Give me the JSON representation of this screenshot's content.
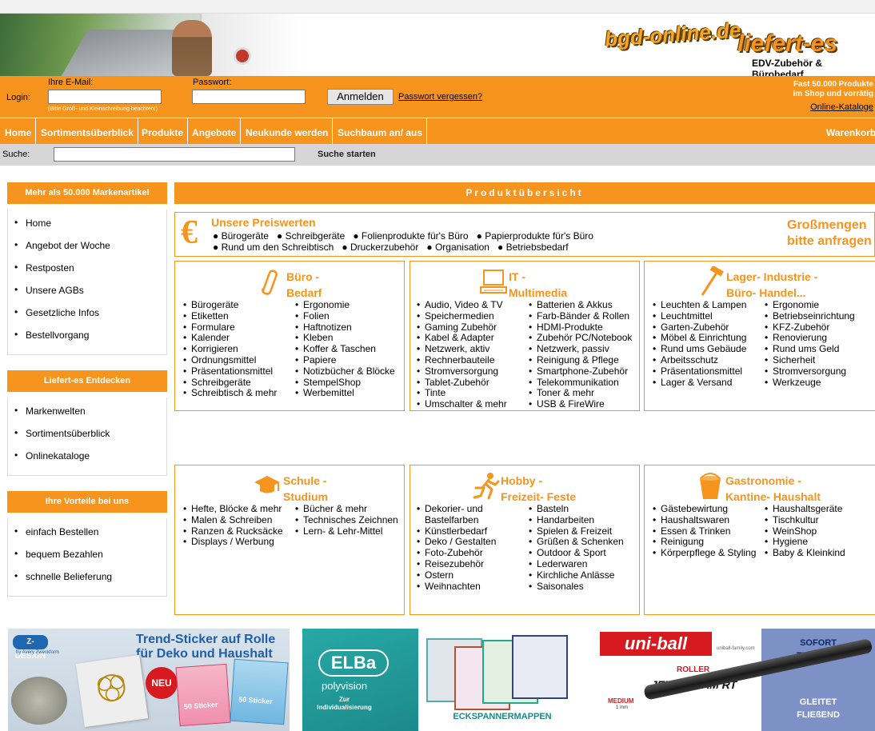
{
  "header": {
    "logo_main": "bgd-online.de",
    "logo_second": "liefert-es",
    "tagline": "EDV-Zubehör & Bürobedarf",
    "promo_line1": "Fast 50.000 Produkte",
    "promo_line2": "im Shop und vorrätig",
    "promo_link": "Online-Kataloge"
  },
  "login": {
    "label": "Login:",
    "email_label": "Ihre E-Mail:",
    "email_value": "",
    "email_hint": "(Bitte Groß- und Kleinschreibung beachten!)",
    "password_label": "Passwort:",
    "password_value": "",
    "submit_label": "Anmelden",
    "forgot_label": "Passwort vergessen?"
  },
  "nav": {
    "items": [
      "Home",
      "Sortimentsüberblick",
      "Produkte",
      "Angebote",
      "Neukunde werden",
      "Suchbaum an/ aus"
    ],
    "cart": "Warenkorb"
  },
  "search": {
    "label": "Suche:",
    "value": "",
    "submit_label": "Suche starten"
  },
  "sidebar": [
    {
      "title": "Mehr als 50.000 Markenartikel",
      "items": [
        "Home",
        "Angebot der Woche",
        "Restposten",
        "Unsere AGBs",
        "Gesetzliche Infos",
        "Bestellvorgang"
      ]
    },
    {
      "title": "Liefert-es Entdecken",
      "items": [
        "Markenwelten",
        "Sortimentsüberblick",
        "Onlinekataloge"
      ]
    },
    {
      "title": "Ihre Vorteile bei uns",
      "items": [
        "einfach Bestellen",
        "bequem Bezahlen",
        "schnelle Belieferung"
      ]
    }
  ],
  "main": {
    "title": "Produktübersicht",
    "preiswert": {
      "title": "Unsere Preiswerten",
      "row1": [
        "Bürogeräte",
        "Schreibgeräte",
        "Folienprodukte für's Büro",
        "Papierprodukte für's Büro"
      ],
      "row2": [
        "Rund um den Schreibtisch",
        "Druckerzubehör",
        "Organisation",
        "Betriebsbedarf"
      ],
      "bulk_line1": "Großmengen",
      "bulk_line2": "bitte anfragen"
    },
    "categories": [
      {
        "title_line1": "Büro -",
        "title_line2": "Bedarf",
        "icon": "paperclip-icon",
        "col1": [
          "Bürogeräte",
          "Etiketten",
          "Formulare",
          "Kalender",
          "Korrigieren",
          "Ordnungsmittel",
          "Präsentationsmittel",
          "Schreibgeräte",
          "Schreibtisch & mehr"
        ],
        "col2": [
          "Ergonomie",
          "Folien",
          "Haftnotizen",
          "Kleben",
          "Koffer & Taschen",
          "Papiere",
          "Notizbücher & Blöcke",
          "StempelShop",
          "Werbemittel"
        ]
      },
      {
        "title_line1": "IT -",
        "title_line2": "Multimedia",
        "icon": "computer-icon",
        "col1": [
          "Audio, Video & TV",
          "Speichermedien",
          "Gaming Zubehör",
          "Kabel & Adapter",
          "Netzwerk, aktiv",
          "Rechnerbauteile",
          "Stromversorgung",
          "Tablet-Zubehör",
          "Tinte",
          "Umschalter & mehr"
        ],
        "col2": [
          "Batterien & Akkus",
          "Farb-Bänder & Rollen",
          "HDMI-Produkte",
          "Zubehör PC/Notebook",
          "Netzwerk, passiv",
          "Reinigung & Pflege",
          "Smartphone-Zubehör",
          "Telekommunikation",
          "Toner & mehr",
          "USB & FireWire"
        ]
      },
      {
        "title_line1": "Lager- Industrie -",
        "title_line2": "Büro- Handel...",
        "icon": "hammer-icon",
        "col1": [
          "Leuchten & Lampen",
          "Leuchtmittel",
          "Garten-Zubehör",
          "Möbel & Einrichtung",
          "Rund ums Gebäude",
          "Arbeitsschutz",
          "Präsentationsmittel",
          "Lager & Versand"
        ],
        "col2": [
          "Ergonomie",
          "Betriebseinrichtung",
          "KFZ-Zubehör",
          "Renovierung",
          "Rund ums Geld",
          "Sicherheit",
          "Stromversorgung",
          "Werkzeuge"
        ]
      },
      {
        "title_line1": "Schule -",
        "title_line2": "Studium",
        "icon": "graduation-cap-icon",
        "col1": [
          "Hefte, Blöcke & mehr",
          "Malen & Schreiben",
          "Ranzen & Rucksäcke",
          "Displays / Werbung"
        ],
        "col2": [
          "Bücher & mehr",
          "Technisches Zeichnen",
          "Lern- & Lehr-Mittel"
        ]
      },
      {
        "title_line1": "Hobby -",
        "title_line2": "Freizeit- Feste",
        "icon": "runner-icon",
        "col1": [
          "Dekorier- und Bastelfarben",
          "Künstlerbedarf",
          "Deko / Gestalten",
          "Foto-Zubehör",
          "Reisezubehör",
          "Ostern",
          "Weihnachten"
        ],
        "col2": [
          "Basteln",
          "Handarbeiten",
          "Spielen & Freizeit",
          "Grüßen & Schenken",
          "Outdoor & Sport",
          "Lederwaren",
          "Kirchliche Anlässe",
          "Saisonales"
        ]
      },
      {
        "title_line1": "Gastronomie -",
        "title_line2": "Kantine- Haushalt",
        "icon": "bucket-icon",
        "col1": [
          "Gästebewirtung",
          "Haushaltswaren",
          "Essen & Trinken",
          "Reinigung",
          "Körperpflege & Styling"
        ],
        "col2": [
          "Haushaltsgeräte",
          "Tischkultur",
          "WeinShop",
          "Hygiene",
          "Baby & Kleinkind"
        ]
      }
    ]
  },
  "banners": [
    {
      "brand": "Z-DESIGN",
      "brand_sub": "by Avery Zweckform",
      "headline1": "Trend-Sticker auf Rolle",
      "headline2": "für Deko und Haushalt",
      "badge": "NEU",
      "pack_label": "50 Sticker"
    },
    {
      "brand": "ELBa",
      "brand_sub": "polyvision",
      "sub1": "Zur",
      "sub2": "Individualisierung",
      "product": "ECKSPANNERMAPPEN"
    },
    {
      "brand": "uni-ball",
      "site": "uniball-family.com",
      "kind": "ROLLER",
      "model": "JETSTREAM RT",
      "size": "MEDIUM",
      "size_sub": "1 mm",
      "claim1a": "SOFORT",
      "claim1b": "TROCKEN",
      "claim2a": "GLEITET",
      "claim2b": "FLIEßEND"
    }
  ],
  "colors": {
    "accent": "#f7941d",
    "searchbar": "#d6d6d6"
  }
}
